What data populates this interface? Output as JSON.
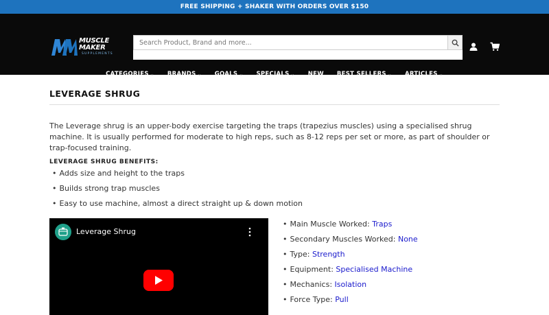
{
  "promo": "FREE SHIPPING + SHAKER WITH ORDERS OVER $150",
  "logo": {
    "line1": "MUSCLE",
    "line2": "MAKER",
    "sub": "SUPPLEMENTS"
  },
  "search": {
    "placeholder": "Search Product, Brand and more..."
  },
  "nav": [
    {
      "label": "CATEGORIES",
      "chevron": true
    },
    {
      "label": "BRANDS",
      "chevron": true
    },
    {
      "label": "GOALS",
      "chevron": true
    },
    {
      "label": "SPECIALS",
      "chevron": true
    },
    {
      "label": "NEW",
      "chevron": false
    },
    {
      "label": "BEST SELLERS",
      "chevron": true
    },
    {
      "label": "ARTICLES",
      "chevron": true
    }
  ],
  "page": {
    "title": "LEVERAGE SHRUG",
    "intro": "The Leverage shrug is an upper-body exercise targeting the traps (trapezius muscles) using a specialised shrug machine. It is usually performed for moderate to high reps, such as 8-12 reps per set or more, as part of shoulder or trap-focused training.",
    "benefits_heading": "LEVERAGE SHRUG BENEFITS:",
    "benefits": [
      "Adds size and height to the traps",
      "Builds strong trap muscles",
      "Easy to use machine, almost a direct straight up & down motion"
    ]
  },
  "video": {
    "title": "Leverage Shrug"
  },
  "specs": [
    {
      "label": "Main Muscle Worked: ",
      "value": "Traps"
    },
    {
      "label": "Secondary Muscles Worked: ",
      "value": "None"
    },
    {
      "label": "Type: ",
      "value": "Strength"
    },
    {
      "label": "Equipment: ",
      "value": "Specialised Machine"
    },
    {
      "label": "Mechanics: ",
      "value": "Isolation"
    },
    {
      "label": "Force Type: ",
      "value": "Pull"
    }
  ],
  "colors": {
    "promo_bg": "#1e73be",
    "header_bg": "#0a0a0a",
    "link": "#1a1acc",
    "play": "#ff0000"
  }
}
